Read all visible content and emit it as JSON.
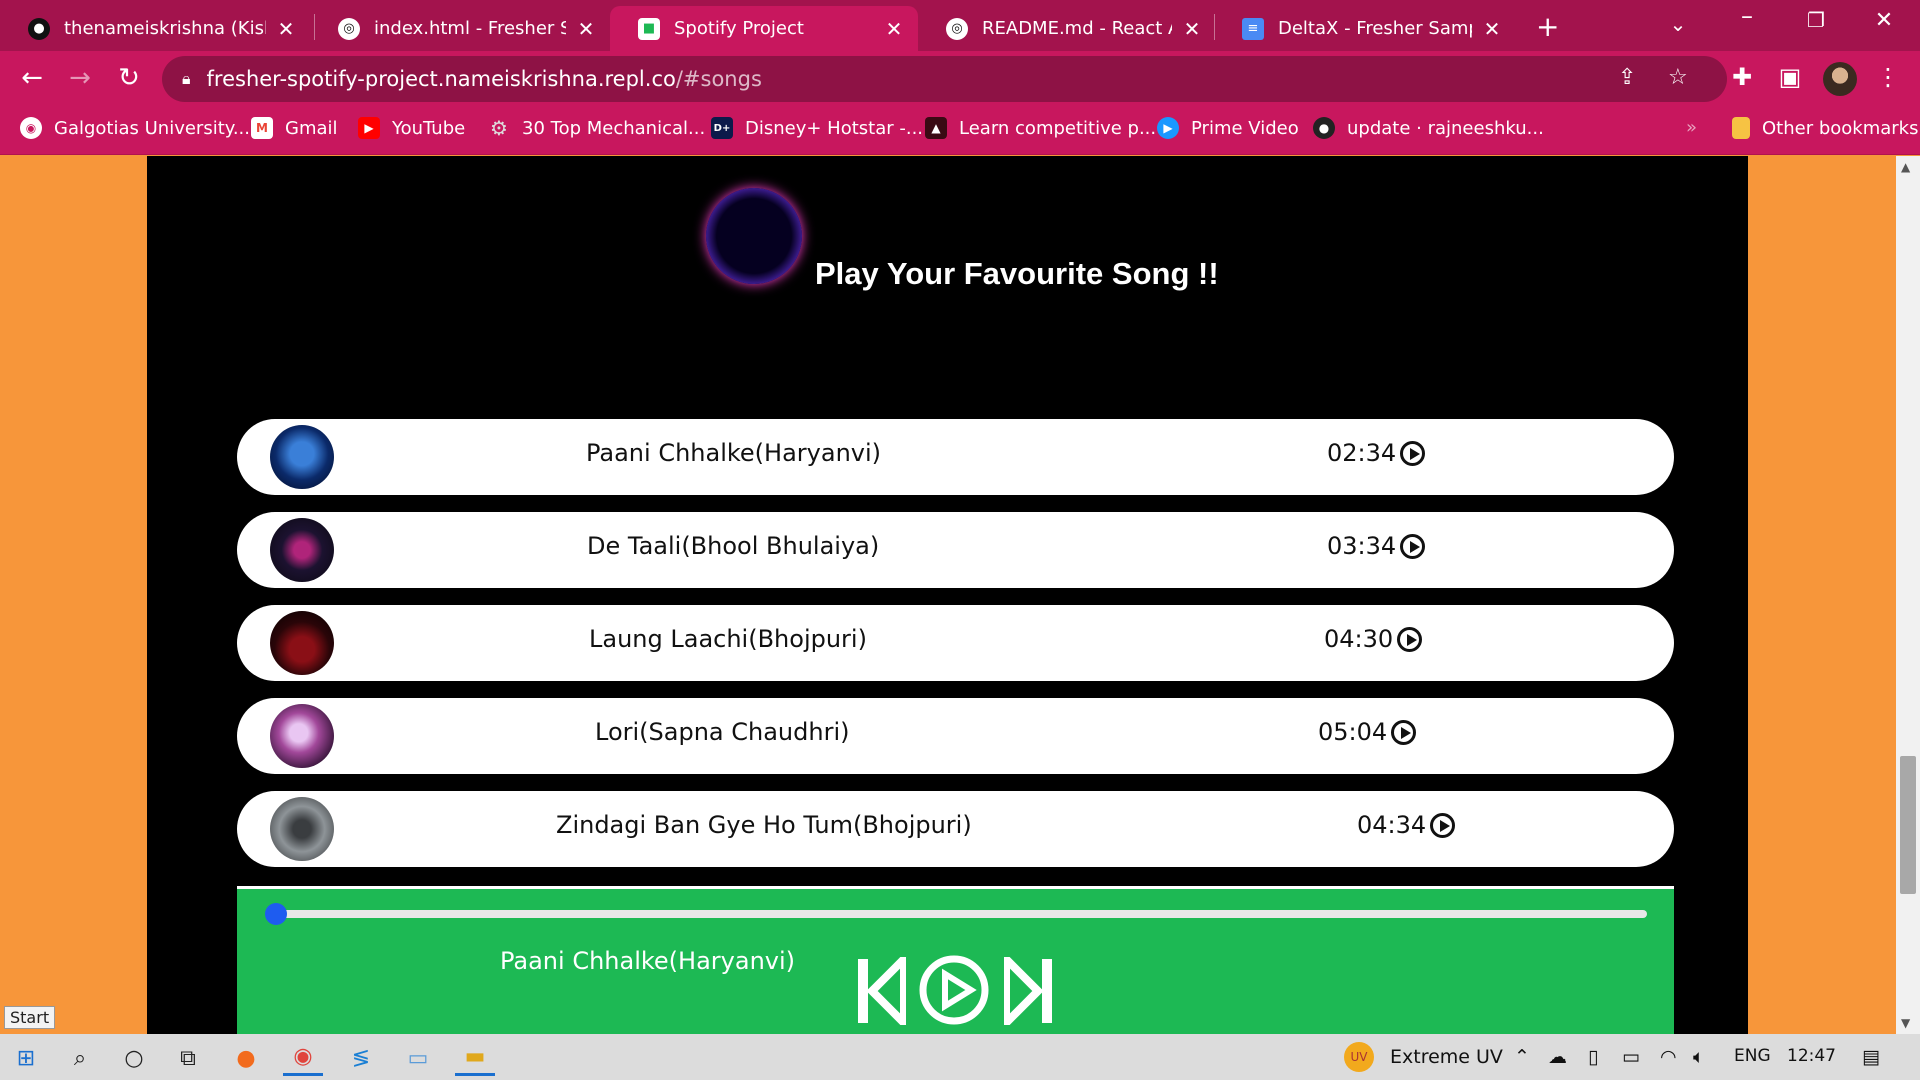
{
  "browser": {
    "tabs": [
      {
        "label": "thenameiskrishna (Kishan",
        "icon": "github-icon"
      },
      {
        "label": "index.html - Fresher Spoti",
        "icon": "replit-icon"
      },
      {
        "label": "Spotify Project",
        "icon": "replit-app-icon"
      },
      {
        "label": "README.md - React App",
        "icon": "replit-icon"
      },
      {
        "label": "DeltaX - Fresher Sample",
        "icon": "google-docs-icon"
      }
    ],
    "active_tab": 2,
    "url_host": "fresher-spotify-project.nameiskrishna.repl.co",
    "url_path": "/#songs",
    "bookmarks": [
      {
        "label": "Galgotias University...",
        "icon": "globe-icon"
      },
      {
        "label": "Gmail",
        "icon": "gmail-icon"
      },
      {
        "label": "YouTube",
        "icon": "youtube-icon"
      },
      {
        "label": "30 Top Mechanical...",
        "icon": "gear-icon"
      },
      {
        "label": "Disney+ Hotstar -...",
        "icon": "hotstar-icon"
      },
      {
        "label": "Learn competitive p...",
        "icon": "book-icon"
      },
      {
        "label": "Prime Video",
        "icon": "prime-video-icon"
      },
      {
        "label": "update · rajneeshku...",
        "icon": "github-icon"
      }
    ],
    "overflow_label": "»",
    "other_bookmarks": "Other bookmarks"
  },
  "page": {
    "heading": "Play Your Favourite Song !!",
    "songs": [
      {
        "title": "Paani Chhalke(Haryanvi)",
        "duration": "02:34"
      },
      {
        "title": "De Taali(Bhool Bhulaiya)",
        "duration": "03:34"
      },
      {
        "title": "Laung Laachi(Bhojpuri)",
        "duration": "04:30"
      },
      {
        "title": "Lori(Sapna Chaudhri)",
        "duration": "05:04"
      },
      {
        "title": "Zindagi Ban Gye Ho Tum(Bhojpuri)",
        "duration": "04:34"
      }
    ],
    "player": {
      "now_playing": "Paani Chhalke(Haryanvi)",
      "progress": 0
    }
  },
  "tooltip": {
    "start": "Start"
  },
  "taskbar": {
    "weather": "Extreme UV",
    "language": "ENG",
    "time": "12:47"
  },
  "colors": {
    "chrome": "#c8175e",
    "page_bg": "#f7963a",
    "player": "#1db954",
    "accent_knob": "#1e5cf0"
  }
}
